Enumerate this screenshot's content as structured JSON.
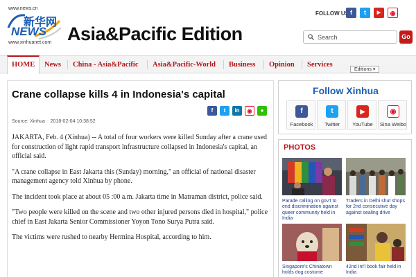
{
  "header": {
    "logo_url_text": "www.news.cn",
    "logo_cn": "新华网",
    "logo_news": "NEWS",
    "logo_domain": "www.xinhuanet.com",
    "edition_title": "Asia&Pacific Edition",
    "follow_us_label": "FOLLOW US",
    "social_icons": [
      "facebook-icon",
      "twitter-icon",
      "youtube-icon",
      "sina-weibo-icon"
    ],
    "search_placeholder": "Search",
    "go_label": "Go"
  },
  "nav": {
    "items": [
      "HOME",
      "News",
      "China - Asia&Pacific",
      "Asia&Pacific-World",
      "Business",
      "Opinion",
      "Services"
    ],
    "editions_label": "Editions ▾"
  },
  "article": {
    "headline": "Crane collapse kills 4 in Indonesia's capital",
    "share_icons": [
      "facebook-icon",
      "twitter-icon",
      "linkedin-icon",
      "weibo-icon",
      "wechat-icon"
    ],
    "source": "Source: Xinhua",
    "date": "2018-02-04 10:38:52",
    "paragraphs": [
      "JAKARTA, Feb. 4 (Xinhua) -- A total of four workers were killed Sunday after a crane used for construction of light rapid transport infrastructure collapsed in Indonesia's capital, an official said.",
      "\"A crane collapse in East Jakarta this (Sunday) morning,\" an official of national disaster management agency told Xinhua by phone.",
      "The incident took place at about 05 :00 a.m. Jakarta time in Matraman district, police said.",
      "\"Two people were killed on the scene and two other injured persons died in hospital,\" police chief in East Jakarta Senior Commissioner Yoyon Tono Surya Putra said.",
      "The victims were rushed to nearby Hermina Hospital, according to him."
    ]
  },
  "follow_xinhua": {
    "title": "Follow Xinhua",
    "items": [
      {
        "label": "Facebook",
        "icon": "facebook-icon",
        "color": "#3b5998",
        "glyph": "f"
      },
      {
        "label": "Twitter",
        "icon": "twitter-icon",
        "color": "#1da1f2",
        "glyph": "t"
      },
      {
        "label": "YouTube",
        "icon": "youtube-icon",
        "color": "#d8261f",
        "glyph": "▶"
      },
      {
        "label": "Sina Weibo",
        "icon": "sina-weibo-icon",
        "color": "#e6162d",
        "glyph": "◉"
      }
    ]
  },
  "photos": {
    "title": "PHOTOS",
    "items": [
      {
        "caption": "Parade calling on gov't to end discrimination against queer community held in India"
      },
      {
        "caption": "Traders in Delhi shut shops for 2nd consecutive day against sealing drive"
      },
      {
        "caption": "Singapore's Chinatown holds dog costume"
      },
      {
        "caption": "42nd Int'l book fair held in India"
      }
    ]
  },
  "colors": {
    "brand_red": "#b3161a",
    "brand_blue": "#1d5fb4",
    "caption_blue": "#1d3e8a"
  }
}
